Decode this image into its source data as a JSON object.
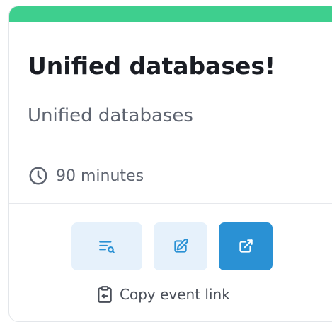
{
  "card": {
    "title": "Unified databases!",
    "subtitle": "Unified databases",
    "duration": "90 minutes",
    "copy_link_label": "Copy event link"
  },
  "icons": {
    "duration": "clock-icon",
    "view": "list-search-icon",
    "edit": "edit-icon",
    "open": "external-link-icon",
    "copy": "clipboard-copy-icon"
  },
  "colors": {
    "accent_stripe": "#3ecf8e",
    "primary_button": "#2a91d4",
    "light_button": "#e6f1fb",
    "icon_blue": "#2a91d4"
  }
}
